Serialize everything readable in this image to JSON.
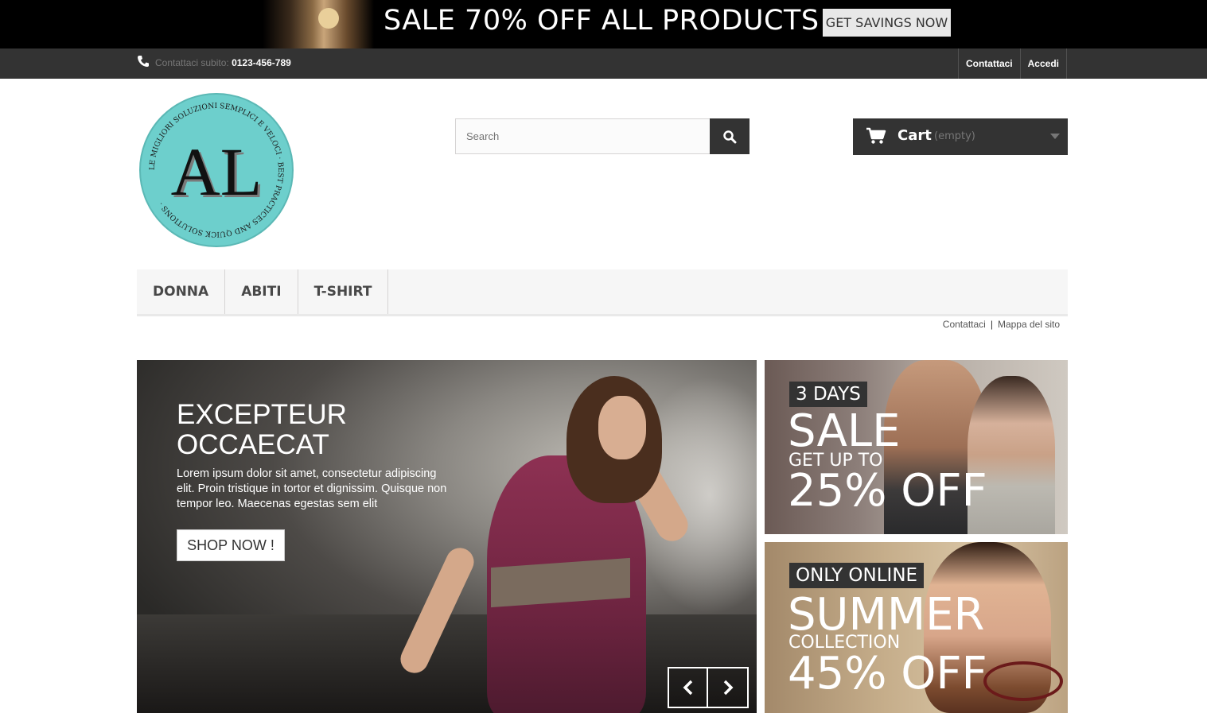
{
  "promo": {
    "title": "SALE 70% OFF ALL PRODUCTS",
    "button": "GET SAVINGS NOW"
  },
  "topnav": {
    "contact_prefix": "Contattaci subito:",
    "phone": "0123-456-789",
    "links": [
      "Contattaci",
      "Accedi"
    ]
  },
  "logo": {
    "letters": "AL",
    "ring_text": "LE MIGLIORI SOLUZIONI SEMPLICI E VELOCI · BEST PRACTICES AND QUICK SOLUTIONS ·"
  },
  "search": {
    "placeholder": "Search"
  },
  "cart": {
    "label": "Cart",
    "status": "(empty)"
  },
  "menu": [
    "DONNA",
    "ABITI",
    "T-SHIRT"
  ],
  "sublinks": {
    "contact": "Contattaci",
    "separator": "|",
    "sitemap": "Mappa del sito"
  },
  "slider": {
    "title": "EXCEPTEUR OCCAECAT",
    "text": "Lorem ipsum dolor sit amet, consectetur adipiscing elit. Proin tristique in tortor et dignissim. Quisque non tempor leo. Maecenas egestas sem elit",
    "button": "SHOP NOW !"
  },
  "banner1": {
    "tag": "3 DAYS",
    "big": "SALE",
    "small": "GET UP TO",
    "off": "25% OFF"
  },
  "banner2": {
    "tag": "ONLY ONLINE",
    "big": "SUMMER",
    "small": "COLLECTION",
    "off": "45% OFF"
  }
}
